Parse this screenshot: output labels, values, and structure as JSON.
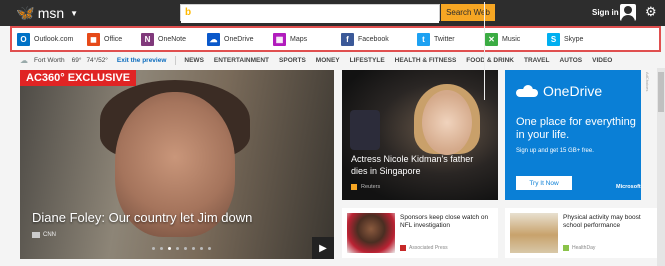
{
  "header": {
    "brand": "msn",
    "search_placeholder": "",
    "search_button": "Search Web",
    "signin": "Sign in"
  },
  "apps": [
    {
      "label": "Outlook.com",
      "icon": "outlook-icon",
      "color": "#0072c6",
      "glyph": "O"
    },
    {
      "label": "Office",
      "icon": "office-icon",
      "color": "#e64a19",
      "glyph": "◼"
    },
    {
      "label": "OneNote",
      "icon": "onenote-icon",
      "color": "#80397b",
      "glyph": "N"
    },
    {
      "label": "OneDrive",
      "icon": "onedrive-icon",
      "color": "#0a58ca",
      "glyph": "☁"
    },
    {
      "label": "Maps",
      "icon": "maps-icon",
      "color": "#b11cbd",
      "glyph": "▦"
    },
    {
      "label": "Facebook",
      "icon": "facebook-icon",
      "color": "#3b5998",
      "glyph": "f"
    },
    {
      "label": "Twitter",
      "icon": "twitter-icon",
      "color": "#1da1f2",
      "glyph": "t"
    },
    {
      "label": "Music",
      "icon": "music-icon",
      "color": "#3bac43",
      "glyph": "✕"
    },
    {
      "label": "Skype",
      "icon": "skype-icon",
      "color": "#00aff0",
      "glyph": "S"
    }
  ],
  "nav": {
    "city": "Fort Worth",
    "temp": "69°",
    "range": "74°/52°",
    "exit": "Exit the preview",
    "items": [
      "News",
      "Entertainment",
      "Sports",
      "Money",
      "Lifestyle",
      "Health & Fitness",
      "Food & Drink",
      "Travel",
      "Autos",
      "Video"
    ]
  },
  "hero": {
    "tag": "AC360° EXCLUSIVE",
    "caption": "Diane Foley: Our country let Jim down",
    "source": "CNN",
    "dots": 8,
    "active_dot": 2
  },
  "mid_story": {
    "caption": "Actress Nicole Kidman's father dies in Singapore",
    "source": "Reuters"
  },
  "ad": {
    "brand": "OneDrive",
    "tagline": "One place for everything in your life.",
    "sub": "Sign up and get 15 GB+ free.",
    "button": "Try It Now",
    "company": "Microsoft",
    "adchoices": "AdChoices"
  },
  "cards": [
    {
      "title": "Sponsors keep close watch on NFL investigation",
      "source": "Associated Press",
      "icon_color": "#c62828"
    },
    {
      "title": "Physical activity may boost school performance",
      "source": "HealthDay",
      "icon_color": "#8bc34a"
    }
  ]
}
